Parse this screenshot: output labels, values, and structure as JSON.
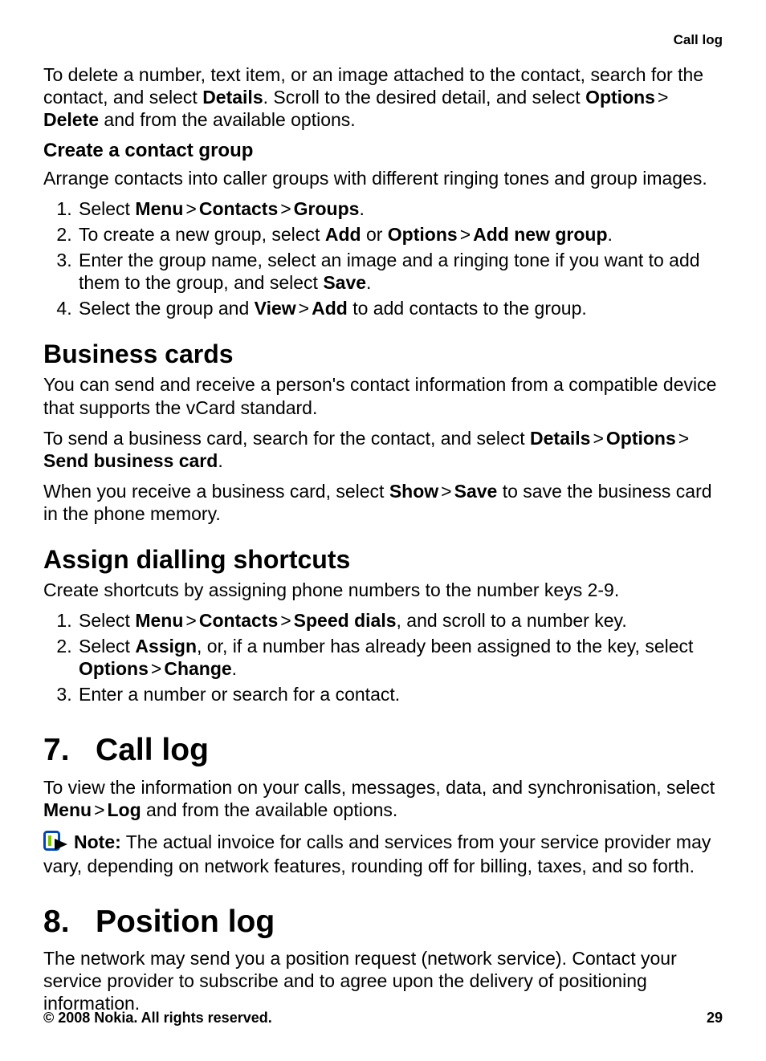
{
  "header": {
    "running": "Call log"
  },
  "delete_detail": {
    "text_before": "To delete a number, text item, or an image attached to the contact, search for the contact, and select ",
    "details": "Details",
    "text_mid": ". Scroll to the desired detail, and select ",
    "options": "Options",
    "delete": "Delete",
    "text_after": " and from the available options."
  },
  "sep": ">",
  "create_group": {
    "heading": "Create a contact group",
    "intro": "Arrange contacts into caller groups with different ringing tones and group images.",
    "step1": {
      "pre": "Select ",
      "menu": "Menu",
      "contacts": "Contacts",
      "groups": "Groups",
      "post": "."
    },
    "step2": {
      "pre": "To create a new group, select ",
      "add": "Add",
      "or": " or ",
      "options": "Options",
      "addnew": "Add new group",
      "post": "."
    },
    "step3": {
      "pre": "Enter the group name, select an image and a ringing tone if you want to add them to the group, and select ",
      "save": "Save",
      "post": "."
    },
    "step4": {
      "pre": "Select the group and ",
      "view": "View",
      "add": "Add",
      "post": " to add contacts to the group."
    }
  },
  "business_cards": {
    "heading": "Business cards",
    "p1": "You can send and receive a person's contact information from a compatible device that supports the vCard standard.",
    "p2": {
      "pre": "To send a business card, search for the contact, and select ",
      "details": "Details",
      "options": "Options",
      "send": "Send business card",
      "post": "."
    },
    "p3": {
      "pre": "When you receive a business card, select ",
      "show": "Show",
      "save": "Save",
      "post": " to save the business card in the phone memory."
    }
  },
  "dialling": {
    "heading": "Assign dialling shortcuts",
    "intro": "Create shortcuts by assigning phone numbers to the number keys 2-9.",
    "step1": {
      "pre": "Select ",
      "menu": "Menu",
      "contacts": "Contacts",
      "speed": "Speed dials",
      "post": ", and scroll to a number key."
    },
    "step2": {
      "pre": "Select ",
      "assign": "Assign",
      "mid": ", or, if a number has already been assigned to the key, select ",
      "options": "Options",
      "change": "Change",
      "post": "."
    },
    "step3": "Enter a number or search for a contact."
  },
  "call_log": {
    "heading_prefix": "7.",
    "heading": "Call log",
    "p1": {
      "pre": "To view the information on your calls, messages, data, and synchronisation, select ",
      "menu": "Menu",
      "log": "Log",
      "post": " and from the available options."
    },
    "note": {
      "label": "Note:",
      "text": " The actual invoice for calls and services from your service provider may vary, depending on network features, rounding off for billing, taxes, and so forth."
    }
  },
  "position_log": {
    "heading_prefix": "8.",
    "heading": "Position log",
    "p1": "The network may send you a position request (network service). Contact your service provider to subscribe and to agree upon the delivery of positioning information."
  },
  "footer": {
    "copyright": "© 2008 Nokia. All rights reserved.",
    "page": "29"
  }
}
